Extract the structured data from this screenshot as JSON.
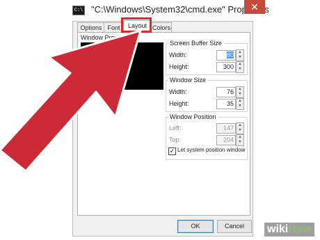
{
  "window": {
    "title": "\"C:\\Windows\\System32\\cmd.exe\" Properties",
    "close_symbol": "✕",
    "icon_text": "C:\\"
  },
  "tabs": [
    {
      "label": "Options"
    },
    {
      "label": "Font"
    },
    {
      "label": "Layout",
      "active": true
    },
    {
      "label": "Colors"
    }
  ],
  "preview": {
    "label": "Window Preview"
  },
  "buffer": {
    "title": "Screen Buffer Size",
    "width_label": "Width:",
    "width_value": "80",
    "height_label": "Height:",
    "height_value": "300"
  },
  "window_size": {
    "title": "Window Size",
    "width_label": "Width:",
    "width_value": "76",
    "height_label": "Height:",
    "height_value": "35"
  },
  "window_position": {
    "title": "Window Position",
    "left_label": "Left:",
    "left_value": "147",
    "top_label": "Top:",
    "top_value": "204",
    "checkbox_label": "Let system position window",
    "checkbox_checked": true
  },
  "buttons": {
    "ok": "OK",
    "cancel": "Cancel"
  },
  "watermark": {
    "part1": "wiki",
    "part2": "How"
  },
  "colors": {
    "highlight": "#e0262b",
    "arrow": "#cc2a36"
  },
  "icons": {
    "spin_up": "▲",
    "spin_down": "▼",
    "check": "✓"
  }
}
